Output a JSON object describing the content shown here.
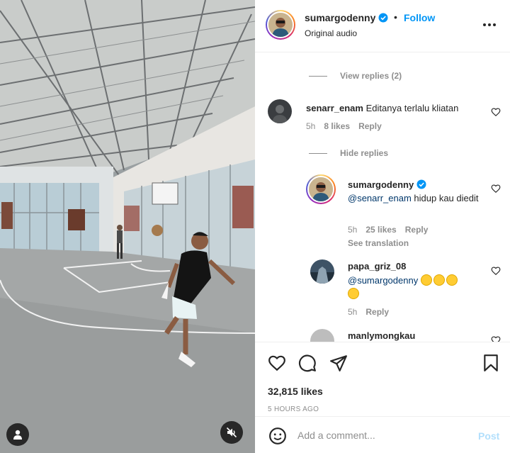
{
  "post": {
    "author": "sumargodenny",
    "follow_label": "Follow",
    "separator": "•",
    "audio": "Original audio",
    "likes": "32,815 likes",
    "date": "5 HOURS AGO"
  },
  "thread": {
    "view_replies": "View replies (2)",
    "hide_replies": "Hide replies",
    "cut_text": "· ",
    "comment": {
      "user": "senarr_enam",
      "text": "Editanya terlalu kliatan",
      "time": "5h",
      "likes": "8 likes",
      "reply": "Reply"
    },
    "replies": [
      {
        "user": "sumargodenny",
        "mention": "@senarr_enam",
        "text": " hidup kau diedit",
        "time": "5h",
        "likes": "25 likes",
        "reply": "Reply",
        "see_translation": "See translation"
      },
      {
        "user": "papa_griz_08",
        "mention": "@sumargodenny",
        "emoji_count": 4,
        "time": "5h",
        "reply": "Reply"
      },
      {
        "user": "manlymongkau"
      }
    ]
  },
  "composer": {
    "placeholder": "Add a comment...",
    "post_label": "Post"
  },
  "colors": {
    "link_blue": "#0095f6",
    "mention": "#00376b",
    "muted": "#8e8e8e",
    "post_disabled": "#b2dffc"
  },
  "icons": [
    "more-icon",
    "verified-icon",
    "heart-icon",
    "comment-icon",
    "share-icon",
    "bookmark-icon",
    "emoji-icon",
    "user-tag-icon",
    "mute-icon"
  ]
}
